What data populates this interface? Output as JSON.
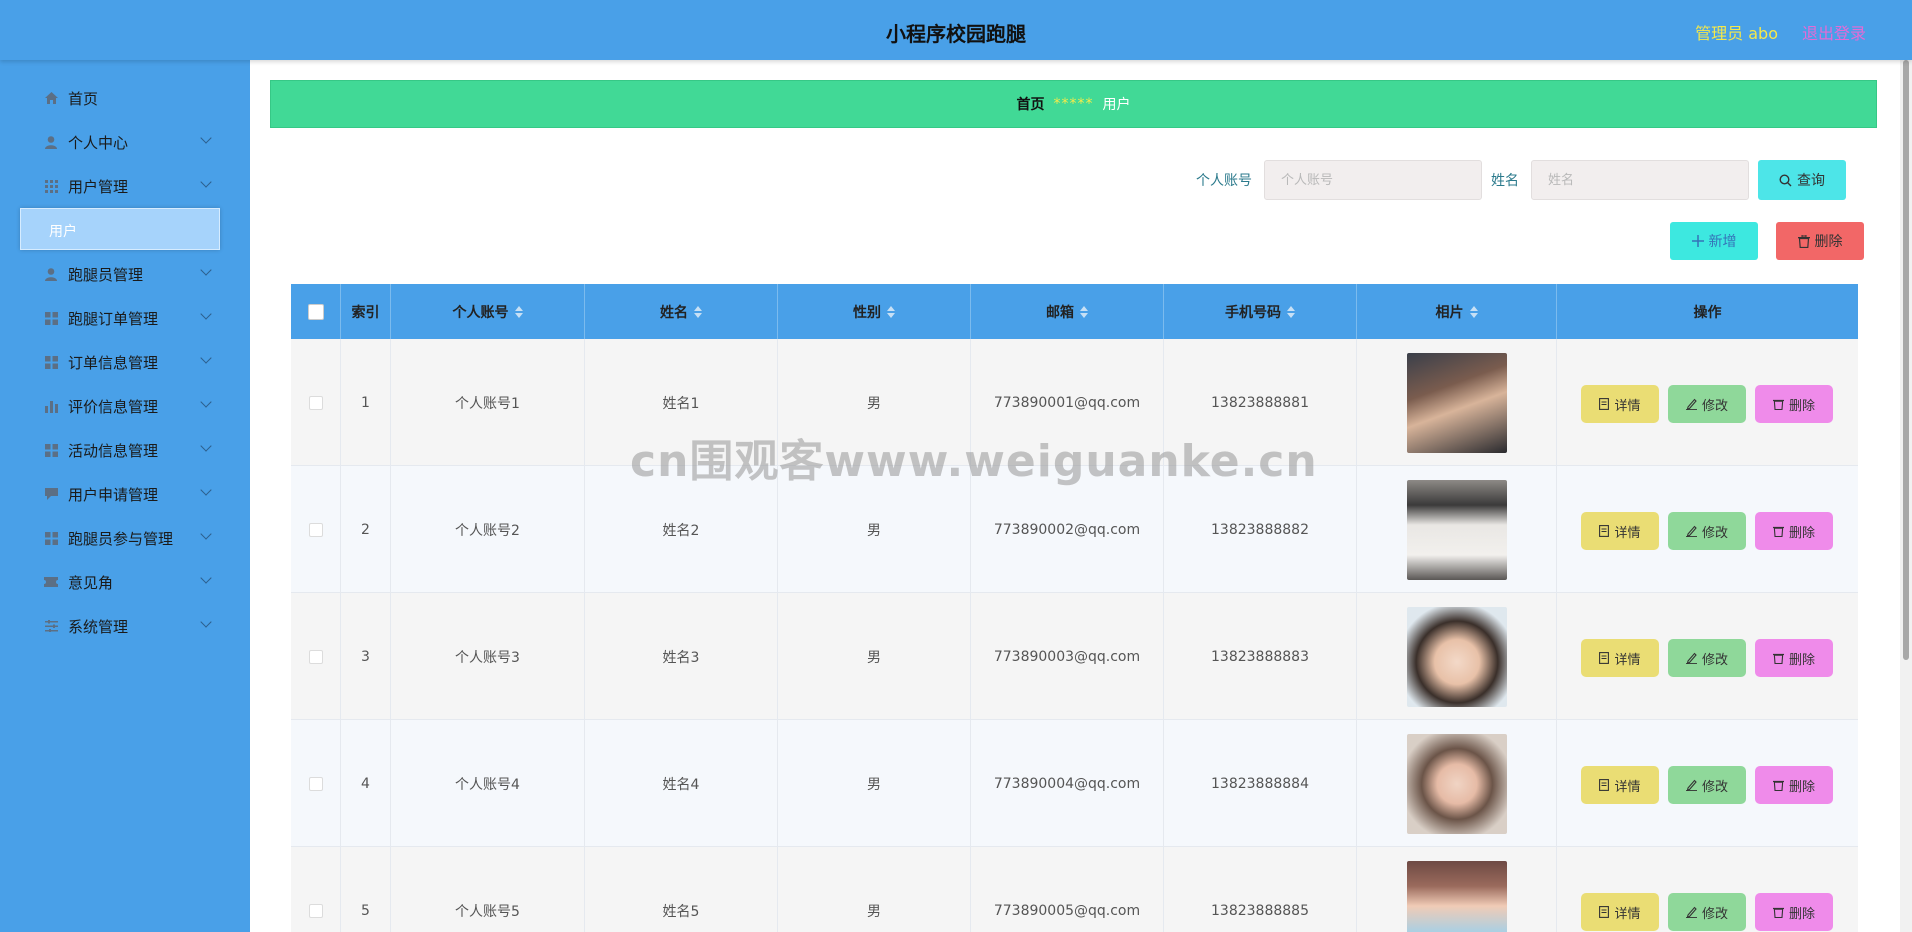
{
  "header": {
    "title": "小程序校园跑腿",
    "admin": "管理员 abo",
    "logout": "退出登录"
  },
  "sidebar": {
    "items": [
      {
        "label": "首页",
        "icon": "home-icon"
      },
      {
        "label": "个人中心",
        "icon": "user-icon"
      },
      {
        "label": "用户管理",
        "icon": "grid-icon"
      },
      {
        "label": "跑腿员管理",
        "icon": "user-icon"
      },
      {
        "label": "跑腿订单管理",
        "icon": "grid-icon"
      },
      {
        "label": "订单信息管理",
        "icon": "grid-icon"
      },
      {
        "label": "评价信息管理",
        "icon": "bar-chart-icon"
      },
      {
        "label": "活动信息管理",
        "icon": "grid-icon"
      },
      {
        "label": "用户申请管理",
        "icon": "chat-icon"
      },
      {
        "label": "跑腿员参与管理",
        "icon": "grid-icon"
      },
      {
        "label": "意见角",
        "icon": "ticket-icon"
      },
      {
        "label": "系统管理",
        "icon": "sliders-icon"
      }
    ],
    "active_sub": "用户"
  },
  "breadcrumb": {
    "home": "首页",
    "separator": "*****",
    "current": "用户"
  },
  "search": {
    "account_label": "个人账号",
    "account_placeholder": "个人账号",
    "name_label": "姓名",
    "name_placeholder": "姓名",
    "query_button": "查询"
  },
  "actions": {
    "add": "新增",
    "delete": "删除"
  },
  "table": {
    "headers": [
      "索引",
      "个人账号",
      "姓名",
      "性别",
      "邮箱",
      "手机号码",
      "相片",
      "操作"
    ],
    "rows": [
      {
        "index": "1",
        "account": "个人账号1",
        "name": "姓名1",
        "gender": "男",
        "email": "773890001@qq.com",
        "phone": "13823888881"
      },
      {
        "index": "2",
        "account": "个人账号2",
        "name": "姓名2",
        "gender": "男",
        "email": "773890002@qq.com",
        "phone": "13823888882"
      },
      {
        "index": "3",
        "account": "个人账号3",
        "name": "姓名3",
        "gender": "男",
        "email": "773890003@qq.com",
        "phone": "13823888883"
      },
      {
        "index": "4",
        "account": "个人账号4",
        "name": "姓名4",
        "gender": "男",
        "email": "773890004@qq.com",
        "phone": "13823888884"
      },
      {
        "index": "5",
        "account": "个人账号5",
        "name": "姓名5",
        "gender": "男",
        "email": "773890005@qq.com",
        "phone": "13823888885"
      }
    ],
    "row_actions": {
      "detail": "详情",
      "edit": "修改",
      "delete": "删除"
    }
  },
  "watermark": "cn围观客www.weiguanke.cn",
  "colors": {
    "header": "#49a0e8",
    "breadcrumb": "#41d996",
    "admin": "#f5e84a",
    "logout": "#e46bd6"
  }
}
